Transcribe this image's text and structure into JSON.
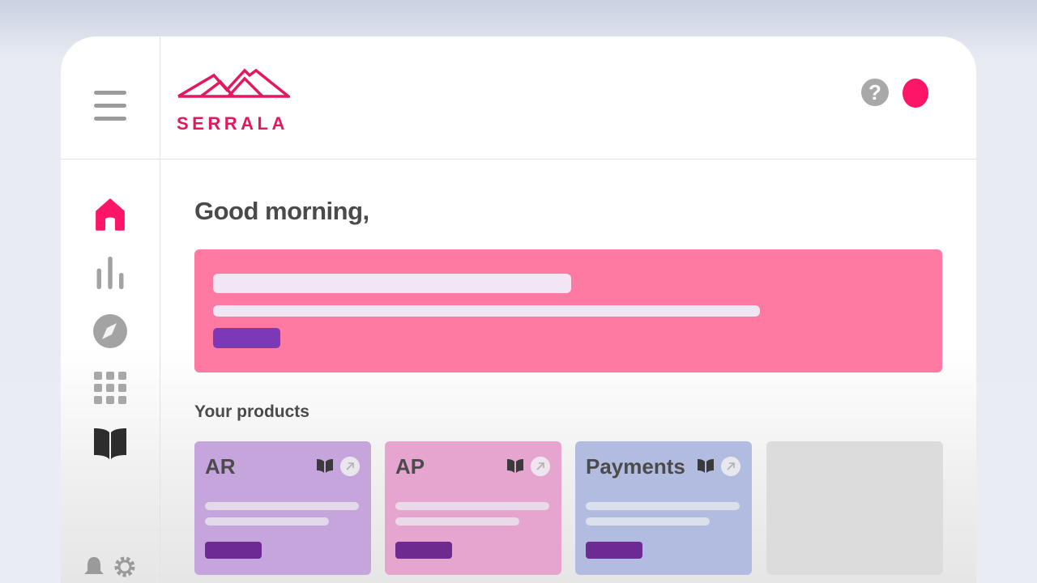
{
  "brand": {
    "name": "SERRALA",
    "color": "#e5175f"
  },
  "header": {
    "help_label": "?"
  },
  "sidebar": {
    "items": [
      {
        "icon": "home-icon",
        "active": true
      },
      {
        "icon": "bar-chart-icon",
        "active": false
      },
      {
        "icon": "compass-icon",
        "active": false
      },
      {
        "icon": "apps-grid-icon",
        "active": false
      },
      {
        "icon": "book-icon",
        "active": false
      }
    ],
    "bottom": [
      {
        "icon": "bell-icon"
      },
      {
        "icon": "gear-icon"
      }
    ]
  },
  "main": {
    "greeting": "Good morning,",
    "products_title": "Your products",
    "products": [
      {
        "name": "AR",
        "color": "#c7a7de"
      },
      {
        "name": "AP",
        "color": "#e7a8d0"
      },
      {
        "name": "Payments",
        "color": "#b2bde2"
      },
      {
        "name": "",
        "color": "#dcdcdc"
      }
    ]
  },
  "colors": {
    "accent": "#fd1667",
    "banner": "#ff7aa2",
    "cta": "#7d38b8"
  }
}
